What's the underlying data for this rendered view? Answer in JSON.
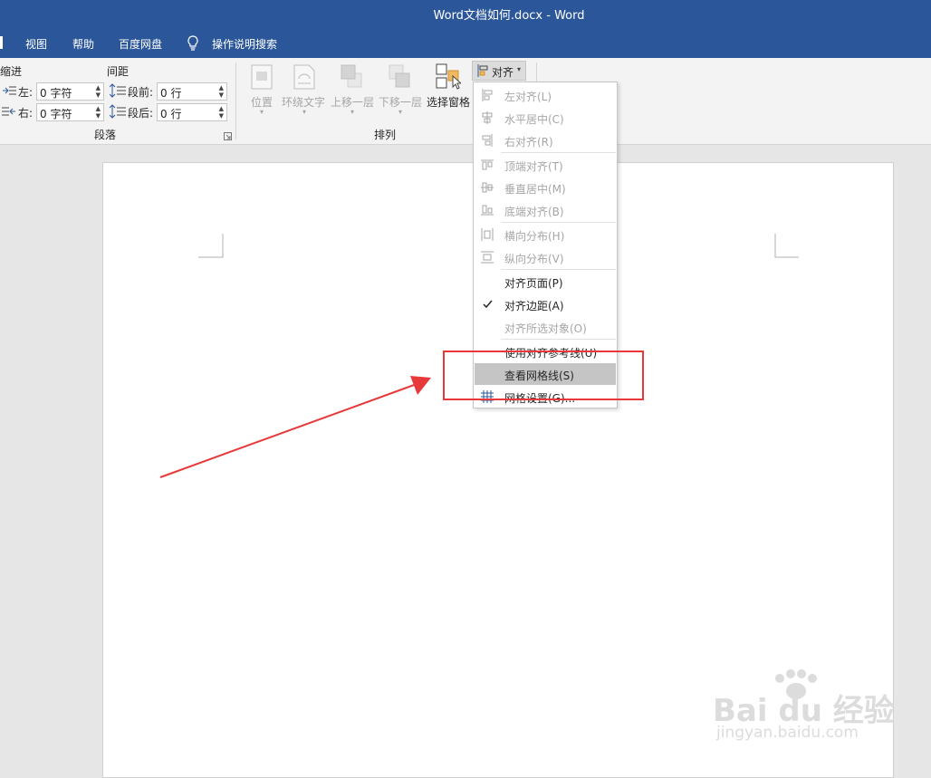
{
  "window": {
    "title": "Word文档如何.docx  -  Word"
  },
  "menu": {
    "items": [
      {
        "label": "视图"
      },
      {
        "label": "帮助"
      },
      {
        "label": "百度网盘"
      }
    ],
    "tell_me": "操作说明搜索"
  },
  "paragraph_group": {
    "indent_label": "缩进",
    "spacing_label": "间距",
    "left_label": "左:",
    "left_value": "0 字符",
    "right_label": "右:",
    "right_value": "0 字符",
    "before_label": "段前:",
    "before_value": "0 行",
    "after_label": "段后:",
    "after_value": "0 行",
    "group_name": "段落"
  },
  "arrange_group": {
    "position": "位置",
    "wrap_text": "环绕文字",
    "bring_forward": "上移一层",
    "send_backward": "下移一层",
    "selection_pane": "选择窗格",
    "align": "对齐",
    "group_name": "排列"
  },
  "align_menu": {
    "items": [
      {
        "label": "左对齐(L)",
        "icon": "align-left-icon",
        "enabled": false
      },
      {
        "label": "水平居中(C)",
        "icon": "align-center-icon",
        "enabled": false
      },
      {
        "label": "右对齐(R)",
        "icon": "align-right-icon",
        "enabled": false
      },
      {
        "label": "顶端对齐(T)",
        "icon": "align-top-icon",
        "enabled": false
      },
      {
        "label": "垂直居中(M)",
        "icon": "align-middle-icon",
        "enabled": false
      },
      {
        "label": "底端对齐(B)",
        "icon": "align-bottom-icon",
        "enabled": false
      },
      {
        "label": "横向分布(H)",
        "icon": "distribute-horizontal-icon",
        "enabled": false
      },
      {
        "label": "纵向分布(V)",
        "icon": "distribute-vertical-icon",
        "enabled": false
      },
      {
        "label": "对齐页面(P)",
        "icon": "",
        "enabled": true
      },
      {
        "label": "对齐边距(A)",
        "icon": "checkmark-icon",
        "enabled": true,
        "checked": true
      },
      {
        "label": "对齐所选对象(O)",
        "icon": "",
        "enabled": false
      },
      {
        "label": "使用对齐参考线(U)",
        "icon": "",
        "enabled": true
      },
      {
        "label": "查看网格线(S)",
        "icon": "",
        "enabled": true,
        "highlighted": true
      },
      {
        "label": "网格设置(G)...",
        "icon": "grid-settings-icon",
        "enabled": true
      }
    ]
  },
  "watermark": {
    "brand": "Bai du 经验",
    "url": "jingyan.baidu.com"
  },
  "colors": {
    "titlebar": "#2b579a",
    "annotation_red": "#e8393a",
    "highlight": "#c5c5c5"
  }
}
